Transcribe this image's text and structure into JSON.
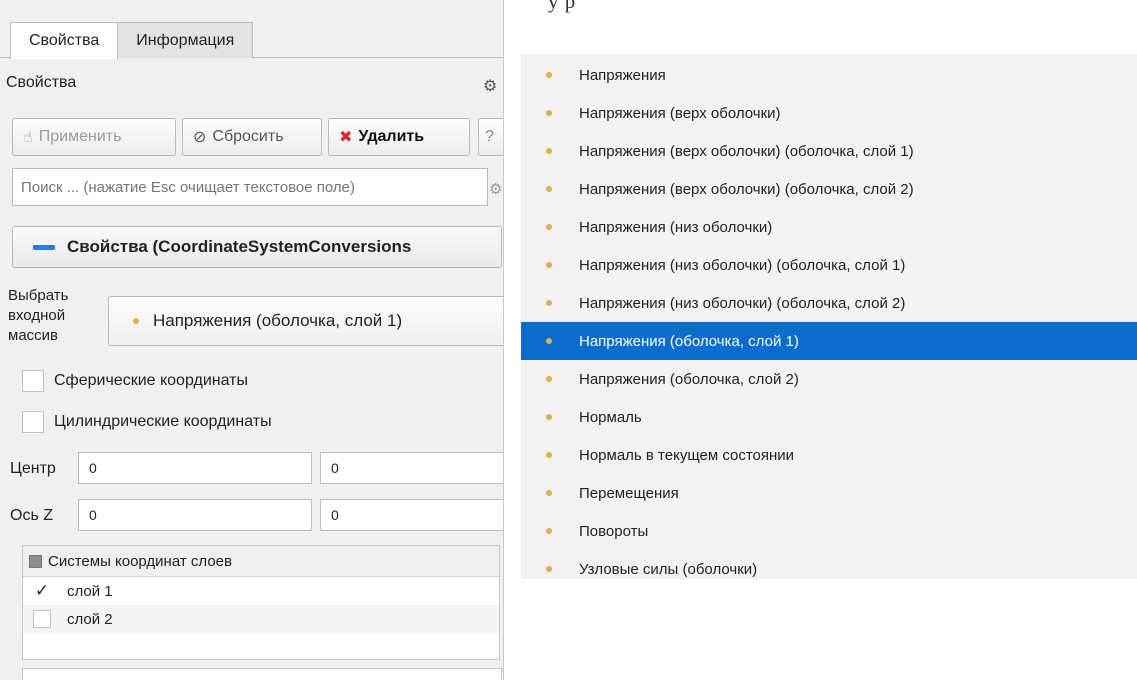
{
  "page_caption_fragment": "у           р",
  "left_panel": {
    "tabs": [
      {
        "label": "Свойства",
        "active": true
      },
      {
        "label": "Информация",
        "active": false
      }
    ],
    "section_title": "Свойства",
    "toolbar": {
      "apply_label": "Применить",
      "reset_label": "Сбросить",
      "delete_label": "Удалить"
    },
    "search": {
      "placeholder": "Поиск ... (нажатие Esc очищает текстовое поле)"
    },
    "group_header": "Свойства (CoordinateSystemConversions",
    "input_array": {
      "label_line1": "Выбрать",
      "label_line2": "входной",
      "label_line3": "массив",
      "selected_value": "Напряжения (оболочка, слой 1)"
    },
    "spherical_label": "Сферические координаты",
    "cylindrical_label": "Цилиндрические координаты",
    "center": {
      "label": "Центр",
      "values": [
        "0",
        "0"
      ]
    },
    "axis_z": {
      "label": "Ось Z",
      "values": [
        "0",
        "0"
      ]
    },
    "layers": {
      "header": "Системы координат слоев",
      "rows": [
        {
          "label": "слой 1",
          "checked": true,
          "mark": "✓"
        },
        {
          "label": "слой 2",
          "checked": false,
          "mark": ""
        }
      ]
    }
  },
  "dropdown": {
    "items": [
      "Напряжения",
      "Напряжения (верх оболочки)",
      "Напряжения (верх оболочки) (оболочка, слой 1)",
      "Напряжения (верх оболочки) (оболочка, слой 2)",
      "Напряжения (низ оболочки)",
      "Напряжения (низ оболочки) (оболочка, слой 1)",
      "Напряжения (низ оболочки) (оболочка, слой 2)",
      "Напряжения (оболочка, слой 1)",
      "Напряжения (оболочка, слой 2)",
      "Нормаль",
      "Нормаль в текущем состоянии",
      "Перемещения",
      "Повороты",
      "Узловые силы (оболочки)"
    ],
    "selected_index": 7
  },
  "colors": {
    "selection": "#0a6dce",
    "bullet": "#e0b04a",
    "delete_icon": "#d8262a",
    "group_minus": "#2f7fd4"
  }
}
